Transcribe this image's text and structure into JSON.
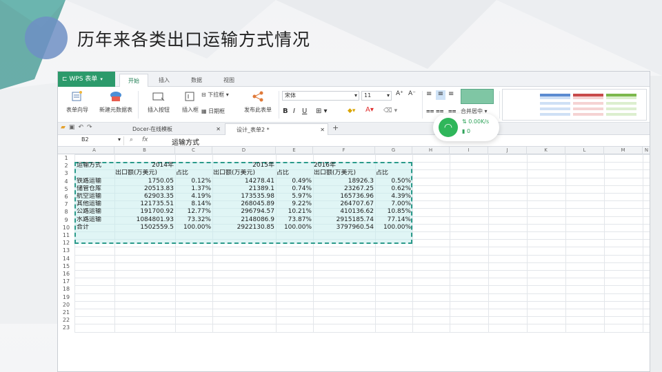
{
  "slide": {
    "title": "历年来各类出口运输方式情况"
  },
  "app": {
    "menu_button": "WPS 表单",
    "tabs": [
      "开始",
      "插入",
      "数据",
      "视图"
    ],
    "active_tab": "开始",
    "ribbon": {
      "form_wizard": "表单向导",
      "new_data_form": "新建元数据表",
      "insert_button": "插入按钮",
      "insert_box": "插入框",
      "dropdown": "下拉框",
      "date_box": "日期框",
      "publish_form": "发布此表单",
      "font_name": "宋体",
      "font_size": "11",
      "merge_center": "合并居中"
    },
    "doc_tabs": [
      {
        "label": "Docer-在线模板",
        "active": false
      },
      {
        "label": "设计_表单2 *",
        "active": true
      }
    ],
    "formula_bar": {
      "name_box": "B2",
      "fx": "fx",
      "content": "运输方式"
    },
    "columns": [
      "A",
      "B",
      "C",
      "D",
      "E",
      "F",
      "G",
      "H",
      "I",
      "J",
      "K",
      "L",
      "M",
      "N"
    ],
    "rows": [
      "1",
      "2",
      "3",
      "4",
      "5",
      "6",
      "7",
      "8",
      "9",
      "10",
      "11",
      "12",
      "13",
      "14",
      "15",
      "16",
      "17",
      "18",
      "19",
      "20",
      "21",
      "22",
      "23"
    ],
    "table": {
      "header_row": [
        "运输方式",
        "2014年",
        "",
        "2015年",
        "",
        "2016年",
        ""
      ],
      "sub_header": [
        "",
        "出口额(万美元)",
        "占比",
        "出口额(万美元)",
        "占比",
        "出口额(万美元)",
        "占比"
      ],
      "rows": [
        [
          "铁路运输",
          "1750.05",
          "0.12%",
          "14278.41",
          "0.49%",
          "18926.3",
          "0.50%"
        ],
        [
          "储管仓库",
          "20513.83",
          "1.37%",
          "21389.1",
          "0.74%",
          "23267.25",
          "0.62%"
        ],
        [
          "航空运输",
          "62903.35",
          "4.19%",
          "173535.98",
          "5.97%",
          "165736.96",
          "4.39%"
        ],
        [
          "其他运输",
          "121735.51",
          "8.14%",
          "268045.89",
          "9.22%",
          "264707.67",
          "7.00%"
        ],
        [
          "公路运输",
          "191700.92",
          "12.77%",
          "296794.57",
          "10.21%",
          "410136.62",
          "10.85%"
        ],
        [
          "水路运输",
          "1084801.93",
          "73.32%",
          "2148086.9",
          "73.87%",
          "2915185.74",
          "77.14%"
        ],
        [
          "合计",
          "1502559.5",
          "100.00%",
          "2922130.85",
          "100.00%",
          "3797960.54",
          "100.00%"
        ]
      ]
    },
    "network": {
      "up": "0.00K/s",
      "down": "0"
    }
  },
  "colors": {
    "accent": "#2c9a6b",
    "selection": "#c6ecec",
    "teal": "#4aa89a",
    "blue": "#5b7fb9"
  }
}
